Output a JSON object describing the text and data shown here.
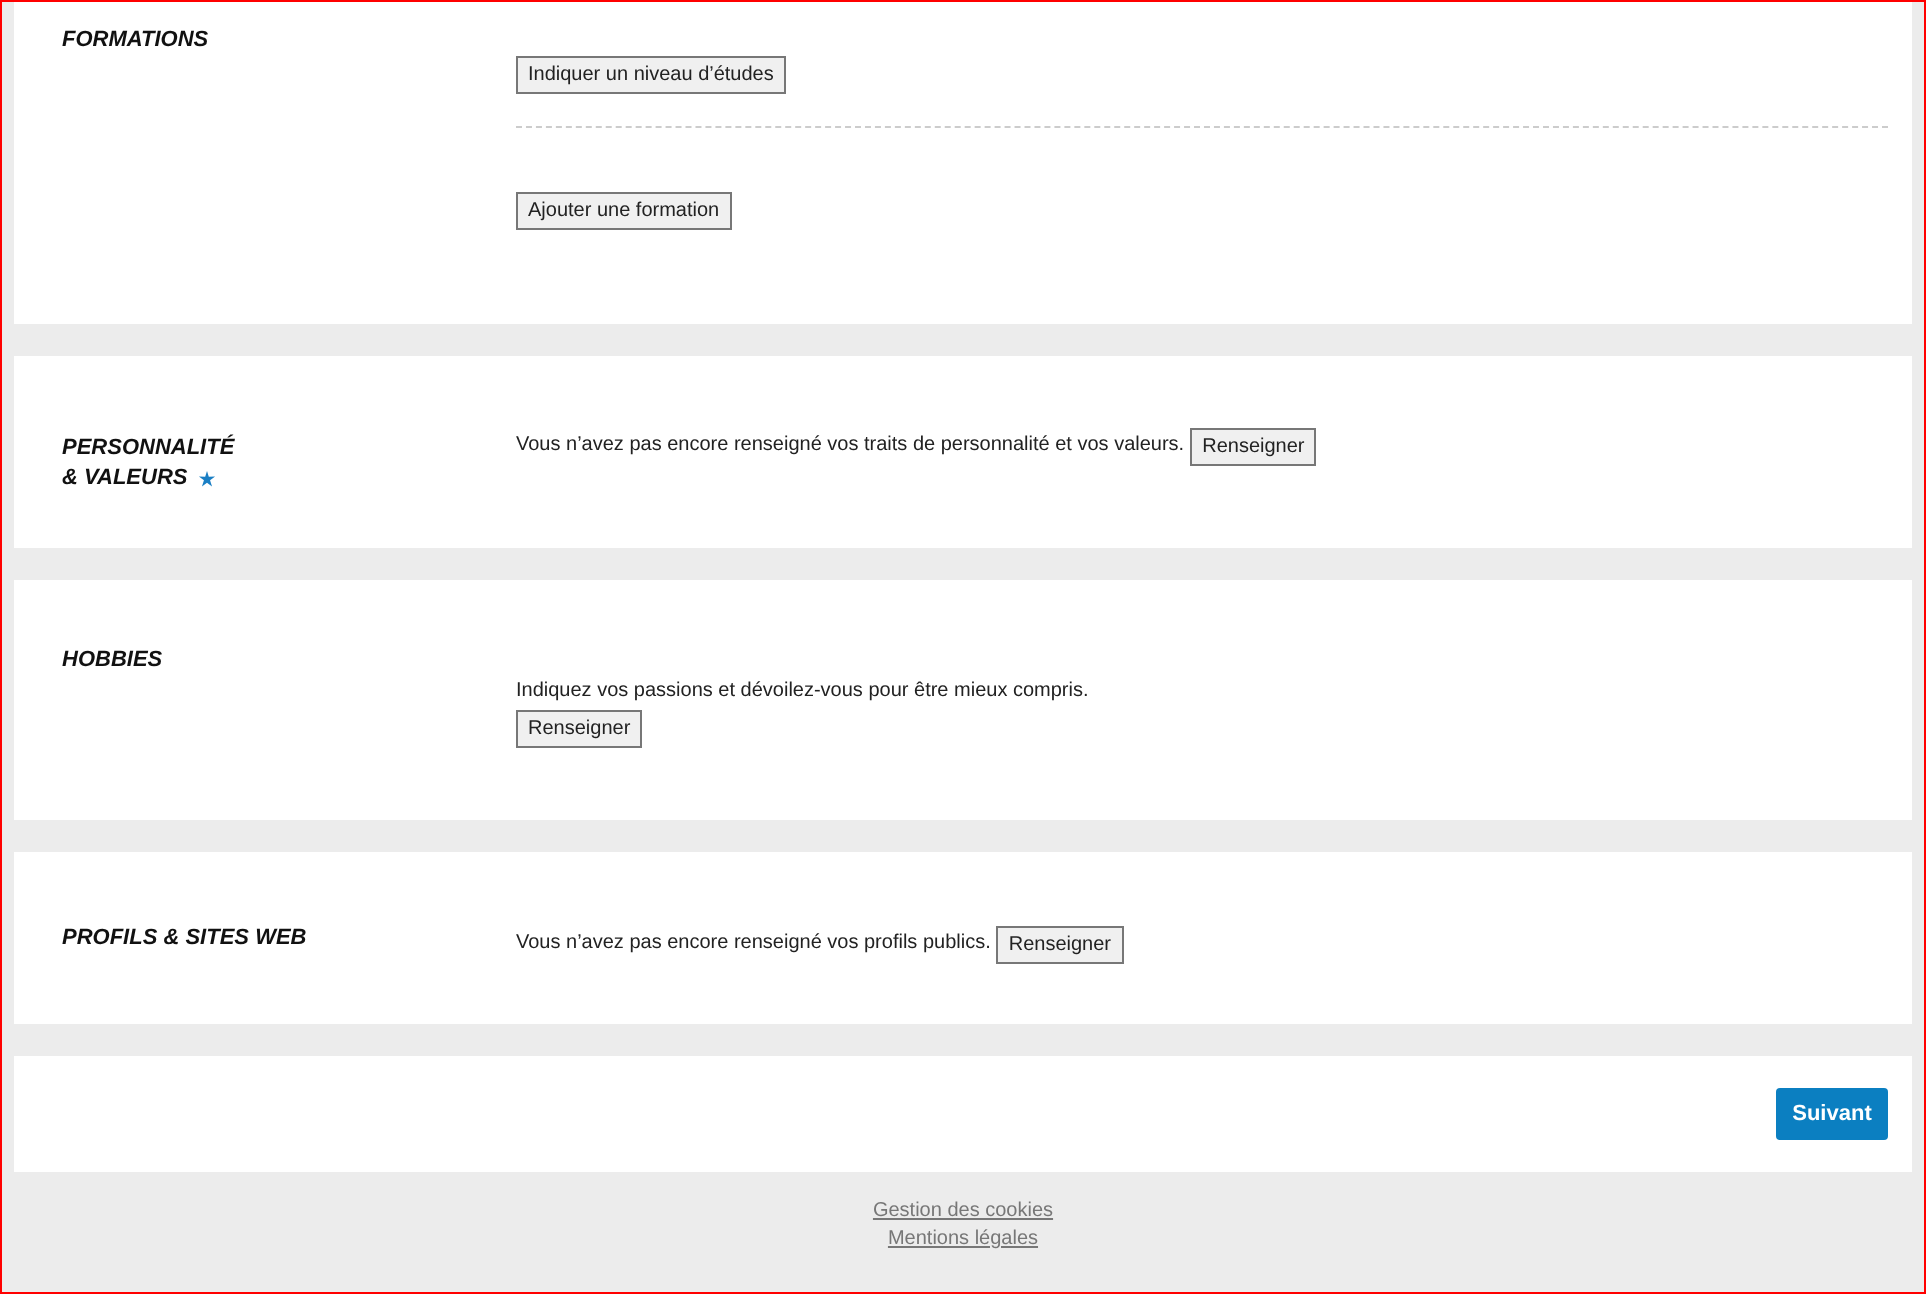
{
  "sections": [
    {
      "kind": "list",
      "title": [
        "FORMATIONS"
      ],
      "required": false,
      "buttons": [
        "Indiquer un niveau d’études",
        "Ajouter une formation"
      ]
    },
    {
      "kind": "inline",
      "title": [
        "PERSONNALITÉ",
        "& VALEURS"
      ],
      "required": true,
      "text": "Vous n’avez pas encore renseigné vos traits de personnalité et vos valeurs.",
      "button": "Renseigner"
    },
    {
      "kind": "stacked",
      "title": [
        "HOBBIES"
      ],
      "required": false,
      "text": "Indiquez vos passions et dévoilez-vous pour être mieux compris.",
      "button": "Renseigner"
    },
    {
      "kind": "inline",
      "title": [
        "PROFILS & SITES WEB"
      ],
      "required": false,
      "text": "Vous n’avez pas encore renseigné vos profils publics.",
      "button": "Renseigner"
    }
  ],
  "next_button": "Suivant",
  "footer_links": [
    "Gestion des cookies",
    "Mentions légales"
  ]
}
